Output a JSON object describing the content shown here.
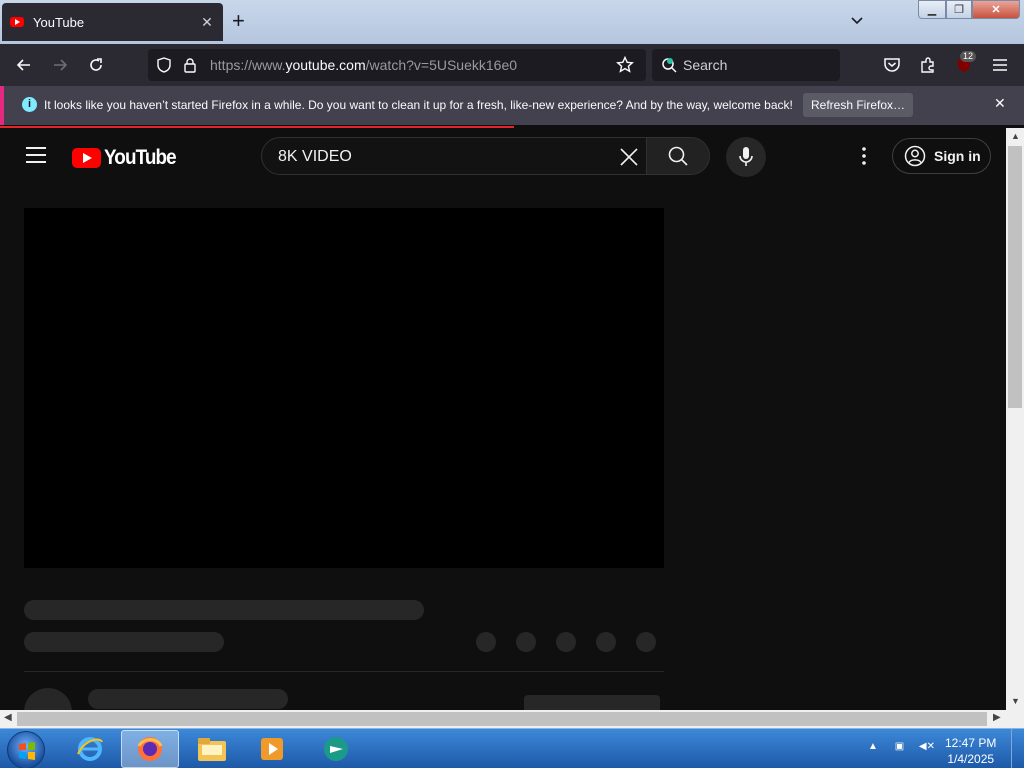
{
  "browser": {
    "tab_title": "YouTube",
    "url_prefix": "https://www.",
    "url_domain": "youtube.com",
    "url_path": "/watch?v=5USuekk16e0",
    "search_placeholder": "Search",
    "extensions_badge": "12"
  },
  "notification": {
    "message": "It looks like you haven’t started Firefox in a while. Do you want to clean it up for a fresh, like-new experience? And by the way, welcome back!",
    "button_label": "Refresh Firefox…"
  },
  "youtube": {
    "logo_text": "YouTube",
    "search_query": "8K VIDEO",
    "sign_in_label": "Sign in"
  },
  "taskbar": {
    "time": "12:47 PM",
    "date": "1/4/2025"
  },
  "colors": {
    "youtube_red": "#ff0000",
    "firefox_toolbar": "#2b2a33",
    "notification_accent": "#e42a80"
  }
}
